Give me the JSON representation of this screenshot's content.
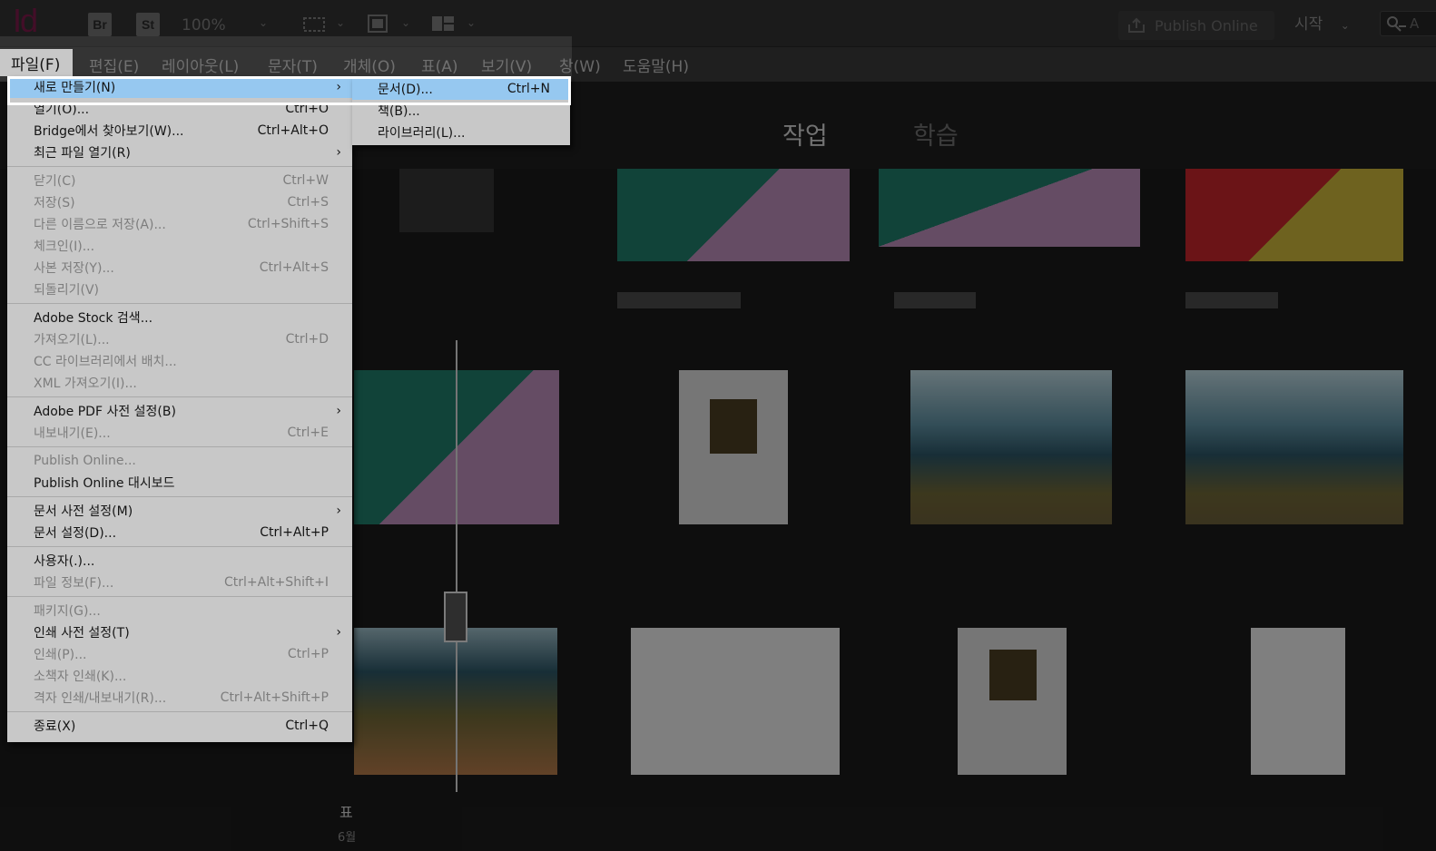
{
  "appbar": {
    "logo": "Id",
    "bridge_badge": "Br",
    "stock_badge": "St",
    "zoom": "100%",
    "publish_online": "Publish Online",
    "start": "시작",
    "search_fragment": "A",
    "icons": [
      "frame-icon",
      "screen-mode-icon",
      "layout-icon",
      "share-icon",
      "user-search-icon",
      "chevron-down-icon"
    ]
  },
  "menubar": {
    "items": [
      "파일(F)",
      "편집(E)",
      "레이아웃(L)",
      "문자(T)",
      "개체(O)",
      "표(A)",
      "보기(V)",
      "창(W)",
      "도움말(H)"
    ]
  },
  "workspace": {
    "tab_work": "작업",
    "tab_learn": "학습",
    "recent_label_fragment": "표",
    "recent_date_fragment": "6월"
  },
  "file_menu": {
    "items": [
      {
        "label": "새로 만들기(N)",
        "shortcut": "",
        "submenu": true,
        "disabled": false,
        "selected": true
      },
      {
        "label": "열기(O)...",
        "shortcut": "Ctrl+O",
        "submenu": false,
        "disabled": false
      },
      {
        "label": "Bridge에서 찾아보기(W)...",
        "shortcut": "Ctrl+Alt+O",
        "submenu": false,
        "disabled": false
      },
      {
        "label": "최근 파일 열기(R)",
        "shortcut": "",
        "submenu": true,
        "disabled": false
      },
      {
        "separator": true
      },
      {
        "label": "닫기(C)",
        "shortcut": "Ctrl+W",
        "submenu": false,
        "disabled": true
      },
      {
        "label": "저장(S)",
        "shortcut": "Ctrl+S",
        "submenu": false,
        "disabled": true
      },
      {
        "label": "다른 이름으로 저장(A)...",
        "shortcut": "Ctrl+Shift+S",
        "submenu": false,
        "disabled": true
      },
      {
        "label": "체크인(I)...",
        "shortcut": "",
        "submenu": false,
        "disabled": true
      },
      {
        "label": "사본 저장(Y)...",
        "shortcut": "Ctrl+Alt+S",
        "submenu": false,
        "disabled": true
      },
      {
        "label": "되돌리기(V)",
        "shortcut": "",
        "submenu": false,
        "disabled": true
      },
      {
        "separator": true
      },
      {
        "label": "Adobe Stock 검색...",
        "shortcut": "",
        "submenu": false,
        "disabled": false
      },
      {
        "label": "가져오기(L)...",
        "shortcut": "Ctrl+D",
        "submenu": false,
        "disabled": true
      },
      {
        "label": "CC 라이브러리에서 배치...",
        "shortcut": "",
        "submenu": false,
        "disabled": true
      },
      {
        "label": "XML 가져오기(I)...",
        "shortcut": "",
        "submenu": false,
        "disabled": true
      },
      {
        "separator": true
      },
      {
        "label": "Adobe PDF 사전 설정(B)",
        "shortcut": "",
        "submenu": true,
        "disabled": false
      },
      {
        "label": "내보내기(E)...",
        "shortcut": "Ctrl+E",
        "submenu": false,
        "disabled": true
      },
      {
        "separator": true
      },
      {
        "label": "Publish Online...",
        "shortcut": "",
        "submenu": false,
        "disabled": true
      },
      {
        "label": "Publish Online 대시보드",
        "shortcut": "",
        "submenu": false,
        "disabled": false
      },
      {
        "separator": true
      },
      {
        "label": "문서 사전 설정(M)",
        "shortcut": "",
        "submenu": true,
        "disabled": false
      },
      {
        "label": "문서 설정(D)...",
        "shortcut": "Ctrl+Alt+P",
        "submenu": false,
        "disabled": false
      },
      {
        "separator": true
      },
      {
        "label": "사용자(.)...",
        "shortcut": "",
        "submenu": false,
        "disabled": false
      },
      {
        "label": "파일 정보(F)...",
        "shortcut": "Ctrl+Alt+Shift+I",
        "submenu": false,
        "disabled": true
      },
      {
        "separator": true
      },
      {
        "label": "패키지(G)...",
        "shortcut": "",
        "submenu": false,
        "disabled": true
      },
      {
        "label": "인쇄 사전 설정(T)",
        "shortcut": "",
        "submenu": true,
        "disabled": false
      },
      {
        "label": "인쇄(P)...",
        "shortcut": "Ctrl+P",
        "submenu": false,
        "disabled": true
      },
      {
        "label": "소책자 인쇄(K)...",
        "shortcut": "",
        "submenu": false,
        "disabled": true
      },
      {
        "label": "격자 인쇄/내보내기(R)...",
        "shortcut": "Ctrl+Alt+Shift+P",
        "submenu": false,
        "disabled": true
      },
      {
        "separator": true
      },
      {
        "label": "종료(X)",
        "shortcut": "Ctrl+Q",
        "submenu": false,
        "disabled": false
      }
    ]
  },
  "new_submenu": {
    "items": [
      {
        "label": "문서(D)...",
        "shortcut": "Ctrl+N",
        "selected": true
      },
      {
        "label": "책(B)...",
        "shortcut": ""
      },
      {
        "label": "라이브러리(L)...",
        "shortcut": ""
      }
    ]
  },
  "colors": {
    "menu_bg": "#c8c8c8",
    "menu_selected": "#96c8f0",
    "logo": "#7b1a4a",
    "app_bg": "#1b1b1b"
  }
}
